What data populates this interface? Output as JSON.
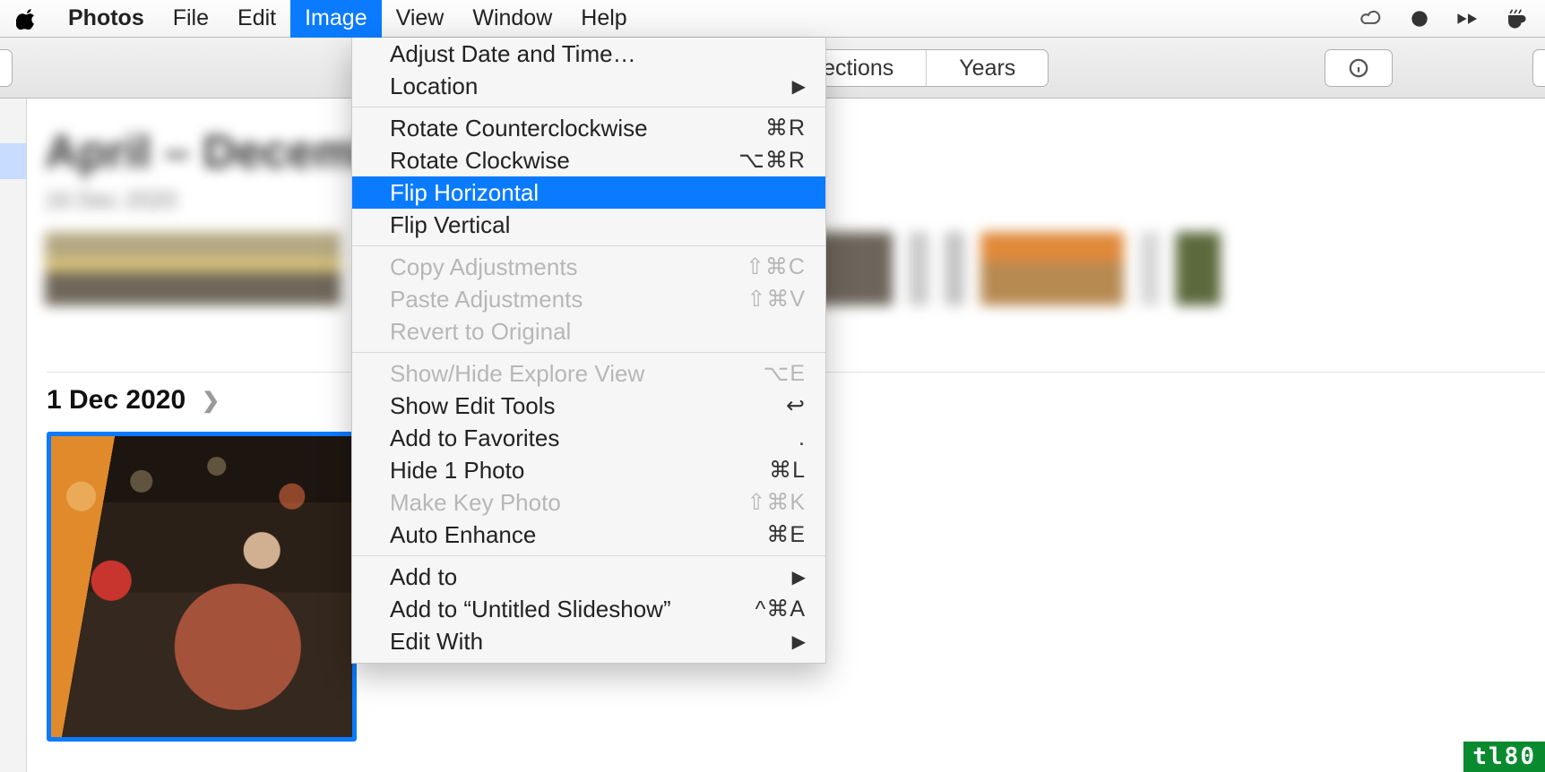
{
  "menubar": {
    "app_name": "Photos",
    "items": [
      "File",
      "Edit",
      "Image",
      "View",
      "Window",
      "Help"
    ],
    "active_index": 2
  },
  "toolbar": {
    "segments": [
      "Collections",
      "Years"
    ]
  },
  "content": {
    "group1_title": "April – December",
    "group1_sub": "16 Dec 2020",
    "group2_date": "1 Dec 2020"
  },
  "dropdown": {
    "items": [
      {
        "label": "Adjust Date and Time…",
        "shortcut": "",
        "disabled": false,
        "submenu": false
      },
      {
        "label": "Location",
        "shortcut": "",
        "disabled": false,
        "submenu": true
      },
      {
        "sep": true
      },
      {
        "label": "Rotate Counterclockwise",
        "shortcut": "⌘R",
        "disabled": false,
        "submenu": false
      },
      {
        "label": "Rotate Clockwise",
        "shortcut": "⌥⌘R",
        "disabled": false,
        "submenu": false
      },
      {
        "label": "Flip Horizontal",
        "shortcut": "",
        "disabled": false,
        "submenu": false,
        "highlight": true
      },
      {
        "label": "Flip Vertical",
        "shortcut": "",
        "disabled": false,
        "submenu": false
      },
      {
        "sep": true
      },
      {
        "label": "Copy Adjustments",
        "shortcut": "⇧⌘C",
        "disabled": true,
        "submenu": false
      },
      {
        "label": "Paste Adjustments",
        "shortcut": "⇧⌘V",
        "disabled": true,
        "submenu": false
      },
      {
        "label": "Revert to Original",
        "shortcut": "",
        "disabled": true,
        "submenu": false
      },
      {
        "sep": true
      },
      {
        "label": "Show/Hide Explore View",
        "shortcut": "⌥E",
        "disabled": true,
        "submenu": false
      },
      {
        "label": "Show Edit Tools",
        "shortcut": "↩",
        "disabled": false,
        "submenu": false
      },
      {
        "label": "Add to Favorites",
        "shortcut": ".",
        "disabled": false,
        "submenu": false
      },
      {
        "label": "Hide 1 Photo",
        "shortcut": "⌘L",
        "disabled": false,
        "submenu": false
      },
      {
        "label": "Make Key Photo",
        "shortcut": "⇧⌘K",
        "disabled": true,
        "submenu": false
      },
      {
        "label": "Auto Enhance",
        "shortcut": "⌘E",
        "disabled": false,
        "submenu": false
      },
      {
        "sep": true
      },
      {
        "label": "Add to",
        "shortcut": "",
        "disabled": false,
        "submenu": true
      },
      {
        "label": "Add to “Untitled Slideshow”",
        "shortcut": "^⌘A",
        "disabled": false,
        "submenu": false
      },
      {
        "label": "Edit With",
        "shortcut": "",
        "disabled": false,
        "submenu": true
      }
    ]
  },
  "watermark": "tl80"
}
